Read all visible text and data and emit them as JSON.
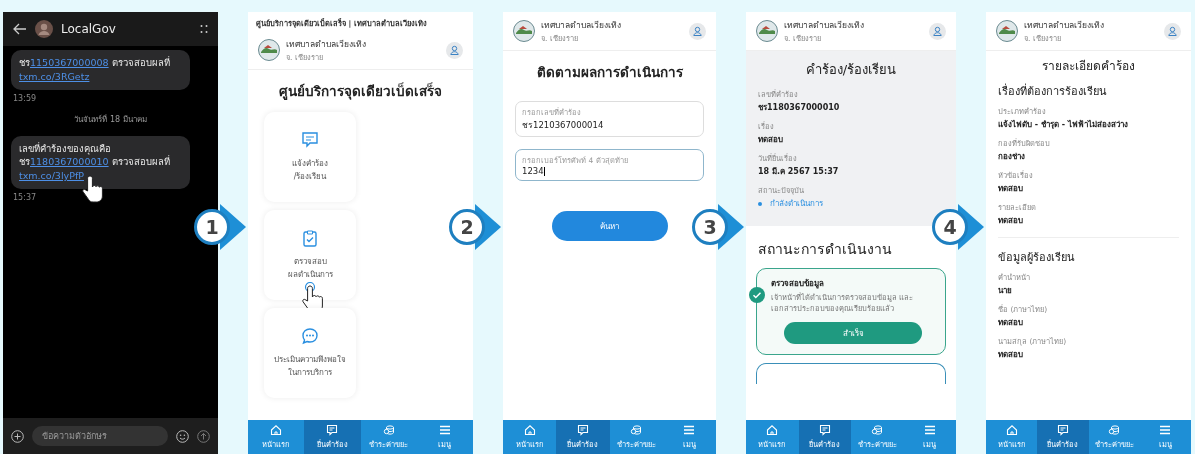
{
  "steps": [
    "1",
    "2",
    "3",
    "4"
  ],
  "sms_screen": {
    "contact": "LocalGov",
    "items": [
      {
        "kind": "message",
        "prefix": "ชร",
        "number": "1150367000008",
        "suffix": " ตรวจสอบผลที่",
        "link": "txm.co/3RGetz",
        "time": "13:59"
      },
      {
        "kind": "divider",
        "text": "วันจันทร์ที่ 18 มีนาคม"
      },
      {
        "kind": "message",
        "intro": "เลขที่คำร้องของคุณคือ",
        "prefix": "ชร",
        "number": "1180367000010",
        "suffix": " ตรวจสอบผลที่",
        "link": "txm.co/3lyPfP",
        "time": "15:37"
      }
    ],
    "input_placeholder": "ข้อความตัวอักษร"
  },
  "services_screen": {
    "breadcrumb": "ศูนย์บริการจุดเดียวเบ็ดเสร็จ | เทศบาลตำบลเวียงเทิง",
    "org": "เทศบาลตำบลเวียงเทิง",
    "district": "จ. เชียงราย",
    "title": "ศูนย์บริการจุดเดียวเบ็ดเสร็จ",
    "cards": [
      {
        "kind": "report",
        "label": "แจ้งคำร้อง\n/ร้องเรียน"
      },
      {
        "kind": "track",
        "label": "ตรวจสอบ\nผลดำเนินการ"
      },
      {
        "kind": "survey",
        "label": "ประเมินความพึงพอใจ\nในการบริการ"
      }
    ],
    "nav": [
      {
        "label": "หน้าแรก",
        "selected": false
      },
      {
        "label": "ยื่นคำร้อง",
        "selected": true
      },
      {
        "label": "ชำระค่าขยะ",
        "selected": false
      },
      {
        "label": "เมนู",
        "selected": false
      }
    ]
  },
  "tracking_screen": {
    "org": "เทศบาลตำบลเวียงเทิง",
    "district": "จ. เชียงราย",
    "title": "ติดตามผลการดำเนินการ",
    "fields": [
      {
        "label": "กรอกเลขที่คำร้อง",
        "value": "ชร1210367000014",
        "focused": false
      },
      {
        "label": "กรอกเบอร์โทรศัพท์ 4 ตัวสุดท้าย",
        "value": "1234",
        "focused": true
      }
    ],
    "button": "ค้นหา",
    "nav": [
      {
        "label": "หน้าแรก",
        "selected": false
      },
      {
        "label": "ยื่นคำร้อง",
        "selected": true
      },
      {
        "label": "ชำระค่าขยะ",
        "selected": false
      },
      {
        "label": "เมนู",
        "selected": false
      }
    ]
  },
  "status_screen": {
    "org": "เทศบาลตำบลเวียงเทิง",
    "district": "จ. เชียงราย",
    "title": "คำร้อง/ร้องเรียน",
    "fields": [
      {
        "label": "เลขที่คำร้อง",
        "value": "ชร1180367000010"
      },
      {
        "label": "เรื่อง",
        "value": "ทดสอบ"
      },
      {
        "label": "วันที่ยื่นเรื่อง",
        "value": "18 มี.ค 2567 15:37"
      }
    ],
    "status": {
      "label": "สถานะปัจจุบัน",
      "value": "กำลังดำเนินการ",
      "color": "#2a8fe0"
    },
    "progress_title": "สถานะการดำเนินงาน",
    "step_card": {
      "title": "ตรวจสอบข้อมูล",
      "description": "เจ้าหน้าที่ได้ดำเนินการตรวจสอบข้อมูล และเอกสารประกอบของคุณเรียบร้อยแล้ว",
      "button": "สำเร็จ",
      "done": true
    },
    "nav": [
      {
        "label": "หน้าแรก",
        "selected": false
      },
      {
        "label": "ยื่นคำร้อง",
        "selected": true
      },
      {
        "label": "ชำระค่าขยะ",
        "selected": false
      },
      {
        "label": "เมนู",
        "selected": false
      }
    ]
  },
  "detail_screen": {
    "org": "เทศบาลตำบลเวียงเทิง",
    "district": "จ. เชียงราย",
    "title": "รายละเอียดคำร้อง",
    "sections": [
      {
        "title": "เรื่องที่ต้องการร้องเรียน",
        "fields": [
          {
            "label": "ประเภทคำร้อง",
            "value": "แจ้งไฟดับ - ชำรุด - ไฟฟ้าไม่ส่องสว่าง"
          },
          {
            "label": "กองที่รับผิดชอบ",
            "value": "กองช่าง"
          },
          {
            "label": "หัวข้อเรื่อง",
            "value": "ทดสอบ"
          },
          {
            "label": "รายละเอียด",
            "value": "ทดสอบ"
          }
        ]
      },
      {
        "title": "ข้อมูลผู้ร้องเรียน",
        "fields": [
          {
            "label": "คำนำหน้า",
            "value": "นาย"
          },
          {
            "label": "ชื่อ (ภาษาไทย)",
            "value": "ทดสอบ"
          },
          {
            "label": "นามสกุล (ภาษาไทย)",
            "value": "ทดสอบ"
          }
        ]
      }
    ],
    "nav": [
      {
        "label": "หน้าแรก",
        "selected": false
      },
      {
        "label": "ยื่นคำร้อง",
        "selected": true
      },
      {
        "label": "ชำระค่าขยะ",
        "selected": false
      },
      {
        "label": "เมนู",
        "selected": false
      }
    ]
  }
}
